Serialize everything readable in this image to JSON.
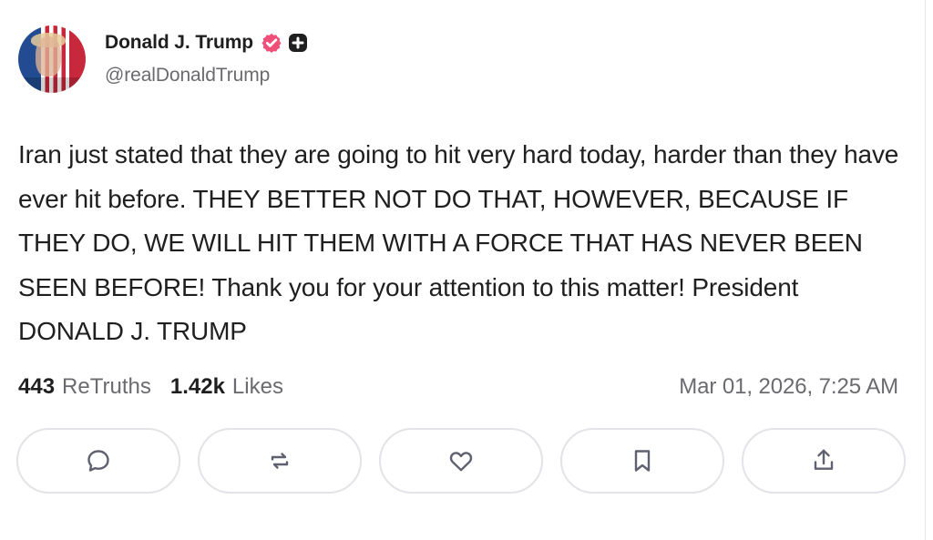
{
  "author": {
    "display_name": "Donald J. Trump",
    "handle": "@realDonaldTrump",
    "verified": true,
    "badges": [
      "verified-icon",
      "plus-icon"
    ]
  },
  "post": {
    "text": "Iran just stated that they are going to hit very hard today, harder than they have ever hit before. THEY BETTER NOT DO THAT, HOWEVER, BECAUSE IF THEY DO, WE WILL HIT THEM WITH A FORCE THAT HAS NEVER BEEN SEEN BEFORE! Thank you for your attention to this matter! President DONALD J. TRUMP"
  },
  "stats": {
    "retruths_count": "443",
    "retruths_label": "ReTruths",
    "likes_count": "1.42k",
    "likes_label": "Likes",
    "timestamp": "Mar 01, 2026, 7:25 AM"
  },
  "actions": [
    {
      "name": "reply",
      "icon": "comment-icon"
    },
    {
      "name": "retruth",
      "icon": "repost-icon"
    },
    {
      "name": "like",
      "icon": "heart-icon"
    },
    {
      "name": "bookmark",
      "icon": "bookmark-icon"
    },
    {
      "name": "share",
      "icon": "share-icon"
    }
  ],
  "colors": {
    "verified_badge": "#ef4f78",
    "plus_badge": "#1f1f1f",
    "secondary_text": "#6b6b6f",
    "button_border": "#e3e3e8",
    "icon_stroke": "#5f6070"
  }
}
